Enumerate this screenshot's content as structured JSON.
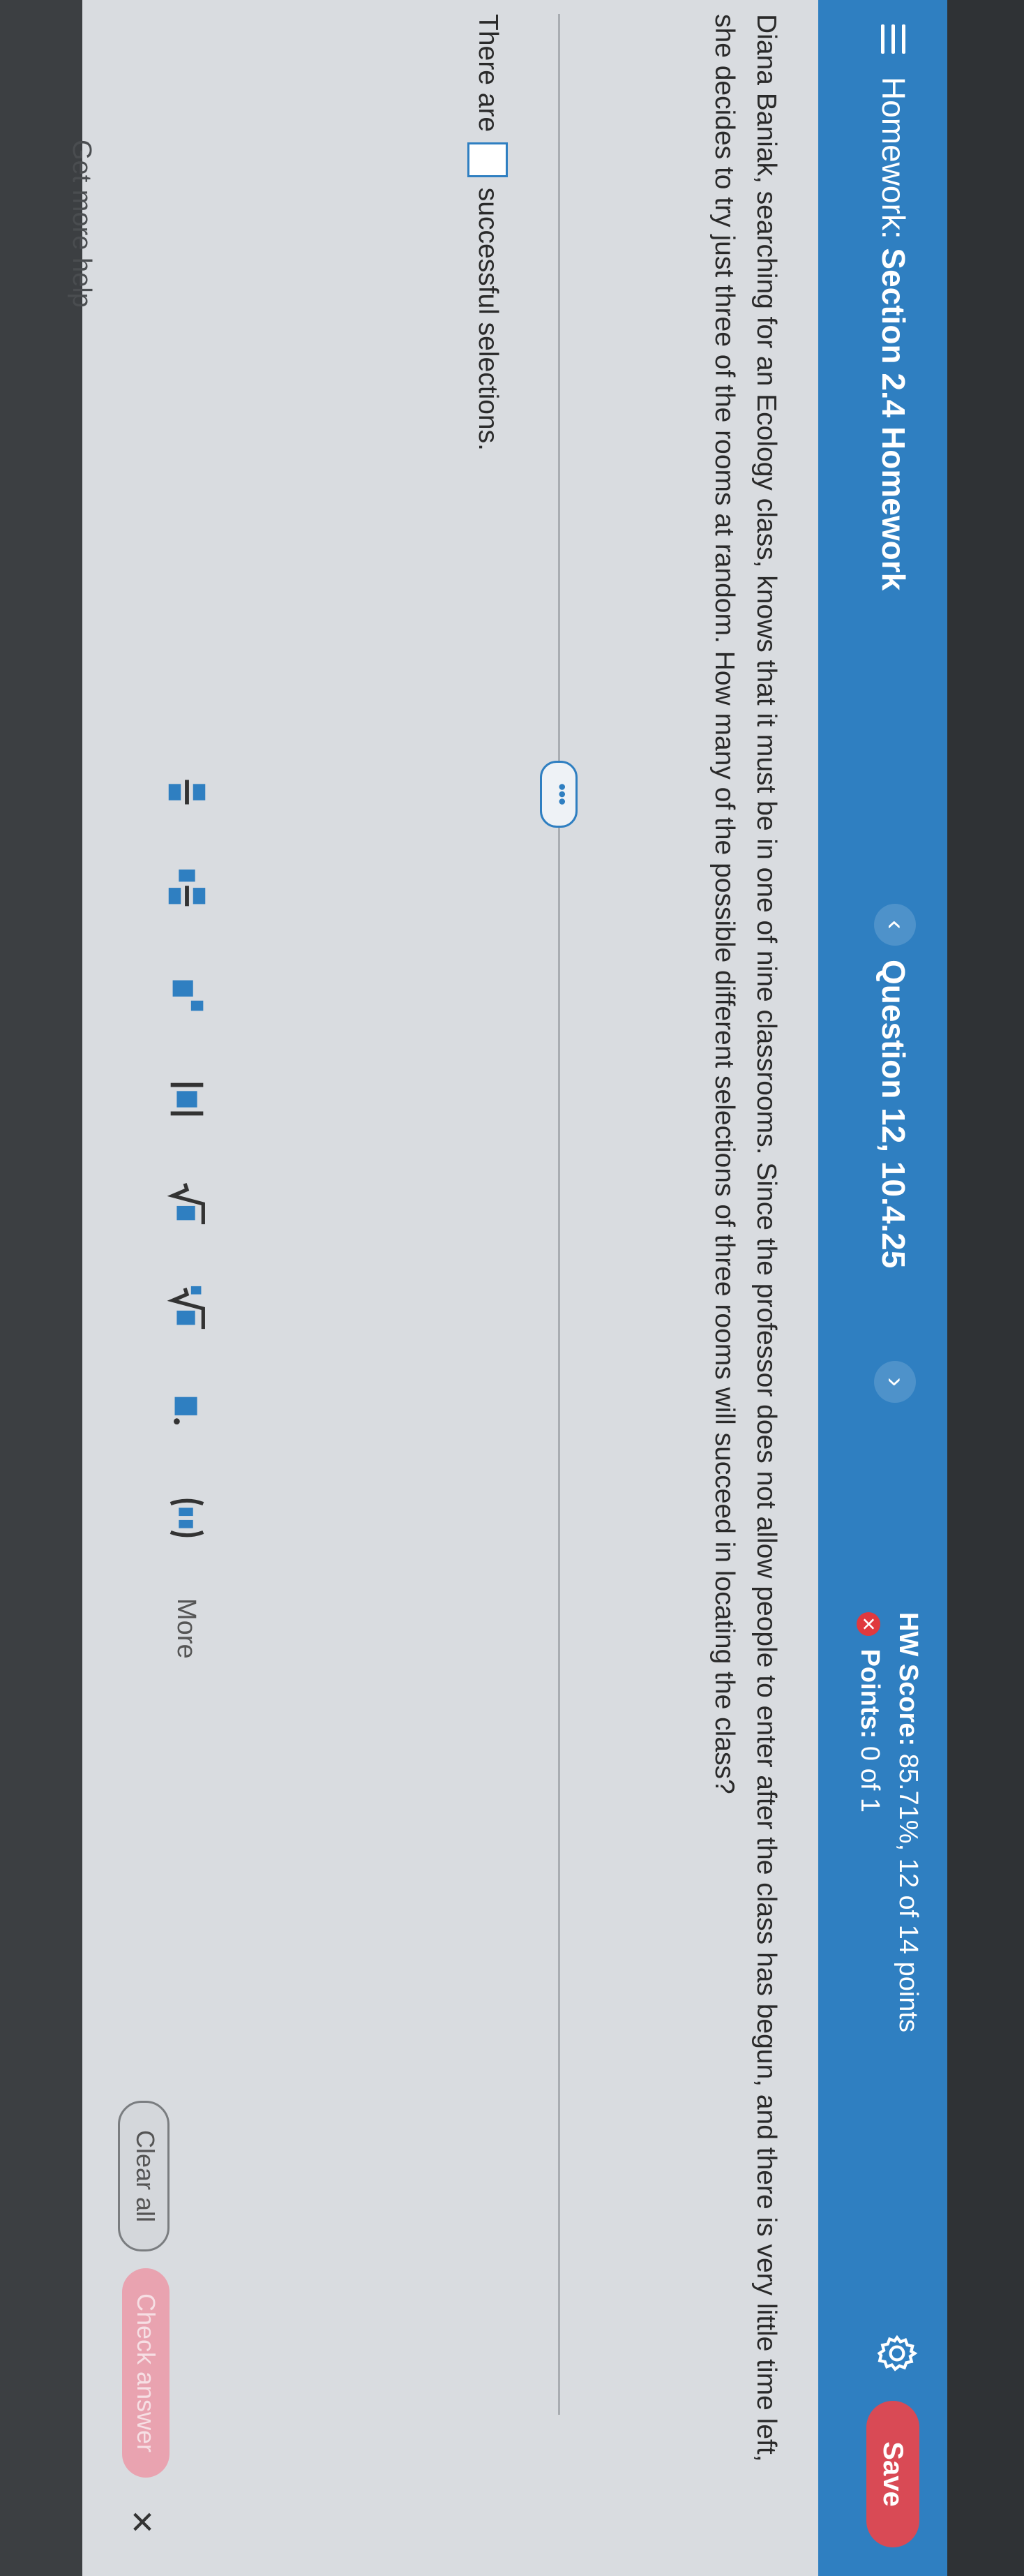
{
  "header": {
    "prefix": "Homework:",
    "title": "Section 2.4 Homework",
    "question_label": "Question 12, 10.4.25",
    "prev_symbol": "‹",
    "next_symbol": "›",
    "score_label": "HW Score:",
    "score_value": "85.71%, 12 of 14 points",
    "points_label": "Points:",
    "points_value": "0 of 1",
    "save_label": "Save"
  },
  "problem": {
    "text": "Diana Baniak, searching for an Ecology class, knows that it must be in one of nine classrooms. Since the professor does not allow people to enter after the class has begun, and there is very little time left, she decides to try just three of the rooms at random. How many of the possible different selections of three rooms will succeed in locating the class?",
    "expand_label": "•••",
    "answer_prefix": "There are",
    "answer_suffix": "successful selections."
  },
  "toolbar": {
    "tools": [
      "fraction-icon",
      "mixed-number-icon",
      "exponent-icon",
      "absolute-value-icon",
      "square-root-icon",
      "nth-root-icon",
      "decimal-icon",
      "ordered-pair-icon"
    ],
    "more_label": "More"
  },
  "footer": {
    "help_text": "Get more help",
    "clear_label": "Clear all",
    "check_label": "Check answer",
    "close_symbol": "✕"
  },
  "colors": {
    "header_bg": "#2f7fc1",
    "save_bg": "#d94a55",
    "check_bg": "#e9a3b0",
    "points_icon": "#e0393e"
  }
}
